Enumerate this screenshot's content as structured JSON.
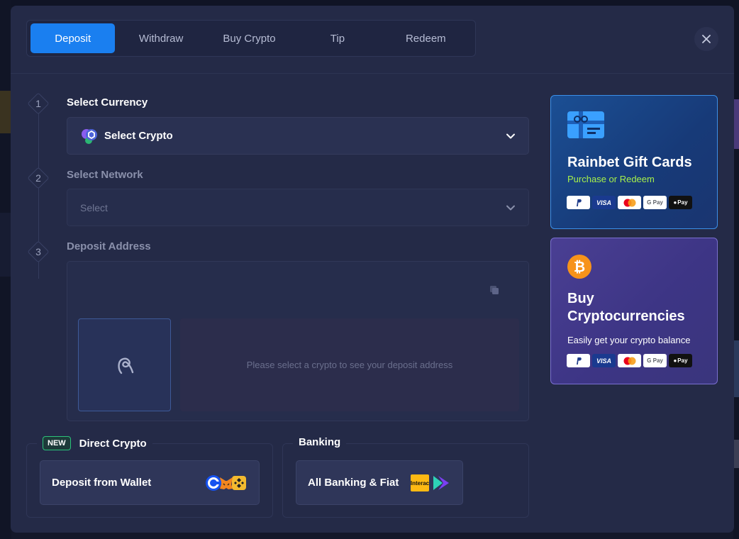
{
  "tabs": [
    {
      "label": "Deposit",
      "active": true
    },
    {
      "label": "Withdraw",
      "active": false
    },
    {
      "label": "Buy Crypto",
      "active": false
    },
    {
      "label": "Tip",
      "active": false
    },
    {
      "label": "Redeem",
      "active": false
    }
  ],
  "close_icon": "close-icon",
  "steps": [
    {
      "number": "1",
      "label": "Select Currency"
    },
    {
      "number": "2",
      "label": "Select Network"
    },
    {
      "number": "3",
      "label": "Deposit Address"
    }
  ],
  "currency_select": {
    "value": "Select Crypto",
    "icon": "crypto-coins-icon"
  },
  "network_select": {
    "placeholder": "Select"
  },
  "deposit_address": {
    "placeholder": "Please select a crypto to see your deposit address",
    "qr_icon": "rainbet-logo-icon"
  },
  "direct_crypto": {
    "badge": "NEW",
    "heading": "Direct Crypto",
    "button_label": "Deposit from Wallet",
    "icons": [
      "coinbase-icon",
      "metamask-icon",
      "binance-icon"
    ]
  },
  "banking": {
    "heading": "Banking",
    "button_label": "All Banking & Fiat",
    "icons": [
      "interac-icon",
      "skrill-icon"
    ]
  },
  "gift_card": {
    "title": "Rainbet Gift Cards",
    "subtitle": "Purchase or Redeem",
    "subtitle_color": "#a6f04a",
    "payments": [
      "PayPal",
      "VISA",
      "Mastercard",
      "G Pay",
      "Apple Pay"
    ]
  },
  "buy_crypto_card": {
    "title_line1": "Buy",
    "title_line2": "Cryptocurrencies",
    "subtitle": "Easily get your crypto balance",
    "payments": [
      "PayPal",
      "VISA",
      "Mastercard",
      "G Pay",
      "Apple Pay"
    ]
  },
  "labels": {
    "gpay": "G Pay",
    "apay": "Pay",
    "visa": "VISA",
    "interac": "Interac"
  },
  "colors": {
    "accent": "#1a7ff0",
    "modal_bg": "#242a47",
    "new_badge": "#2cc37a"
  }
}
